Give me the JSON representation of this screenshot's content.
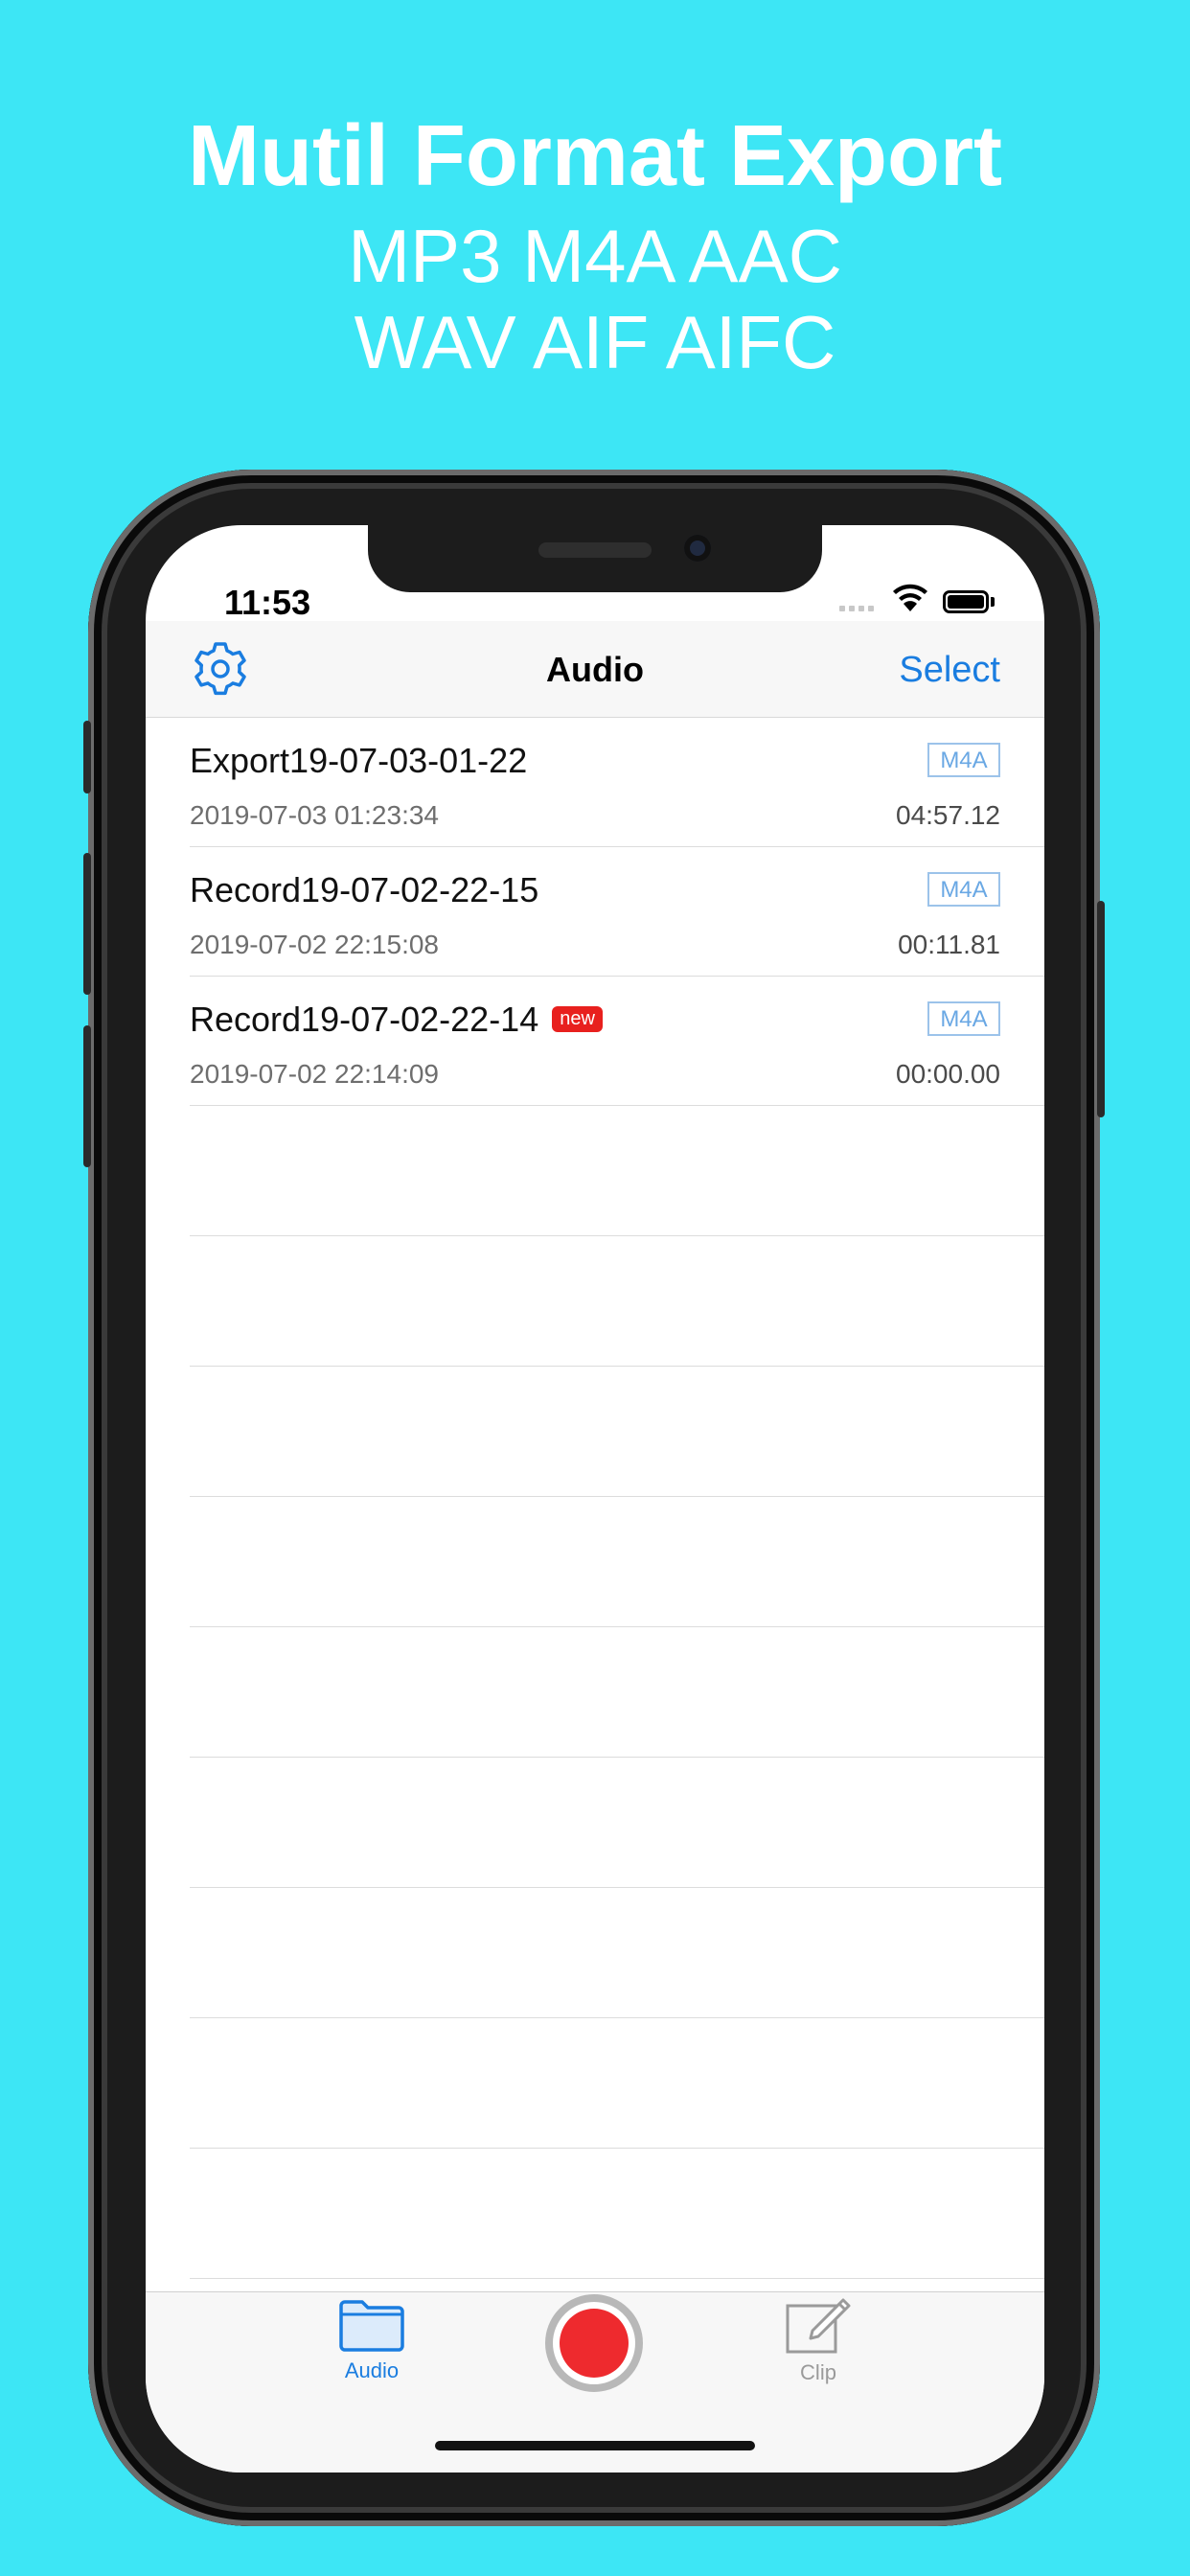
{
  "promo": {
    "title": "Mutil Format Export",
    "line1": "MP3 M4A AAC",
    "line2": "WAV AIF AIFC"
  },
  "status_bar": {
    "time": "11:53"
  },
  "navbar": {
    "settings_icon": "gear-icon",
    "title": "Audio",
    "select_label": "Select"
  },
  "recordings": [
    {
      "name": "Export19-07-03-01-22",
      "format": "M4A",
      "date": "2019-07-03 01:23:34",
      "duration": "04:57.12",
      "is_new": false
    },
    {
      "name": "Record19-07-02-22-15",
      "format": "M4A",
      "date": "2019-07-02 22:15:08",
      "duration": "00:11.81",
      "is_new": false
    },
    {
      "name": "Record19-07-02-22-14",
      "format": "M4A",
      "date": "2019-07-02 22:14:09",
      "duration": "00:00.00",
      "is_new": true,
      "new_label": "new"
    }
  ],
  "tabbar": {
    "audio_label": "Audio",
    "clip_label": "Clip"
  },
  "colors": {
    "background": "#3de6f5",
    "accent": "#1a7de0",
    "record": "#ee2a2e",
    "new_badge": "#e8201e"
  }
}
